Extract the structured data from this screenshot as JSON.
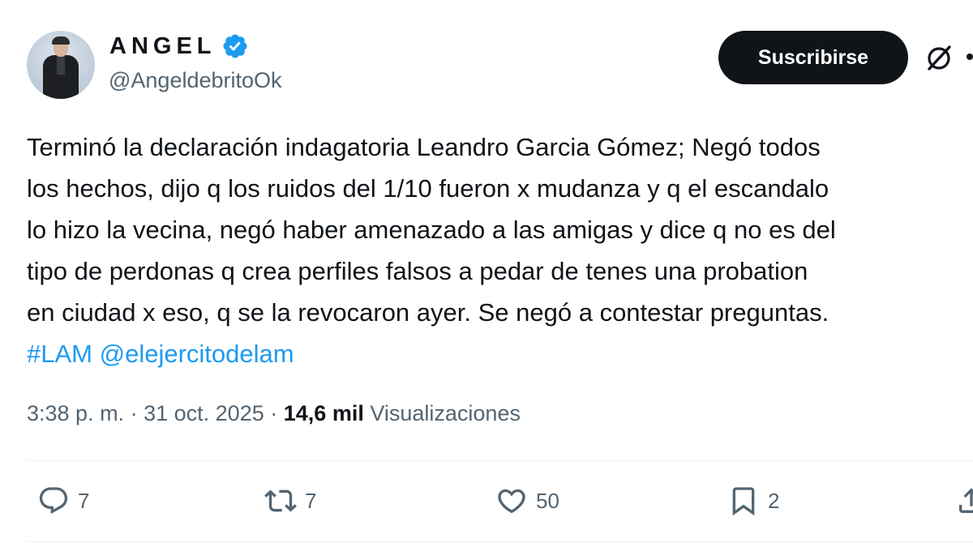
{
  "author": {
    "display_name": "ANGEL",
    "handle": "@AngeldebritoOk",
    "verified": true,
    "verified_color": "#1d9bf0"
  },
  "header": {
    "subscribe_label": "Suscribirse",
    "grok_icon": "grok-icon",
    "more_icon": "more-icon"
  },
  "tweet": {
    "lines": [
      "Terminó la declaración indagatoria Leandro Garcia Gómez; Negó todos",
      "los hechos, dijo q los ruidos del 1/10 fueron x mudanza y q el escandalo",
      "lo hizo la vecina, negó haber amenazado a las amigas y dice q no es del",
      "tipo de perdonas q crea perfiles falsos a pedar de tenes una probation",
      "en ciudad x eso, q se la revocaron ayer. Se negó a contestar preguntas."
    ],
    "hashtag": "#LAM",
    "mention": "@elejercitodelam",
    "link_color": "#1d9bf0"
  },
  "meta": {
    "time": "3:38 p. m.",
    "separator": "·",
    "date": "31 oct. 2025",
    "views_count": "14,6 mil",
    "views_label": "Visualizaciones"
  },
  "actions": {
    "replies": "7",
    "retweets": "7",
    "likes": "50",
    "bookmarks": "2"
  }
}
